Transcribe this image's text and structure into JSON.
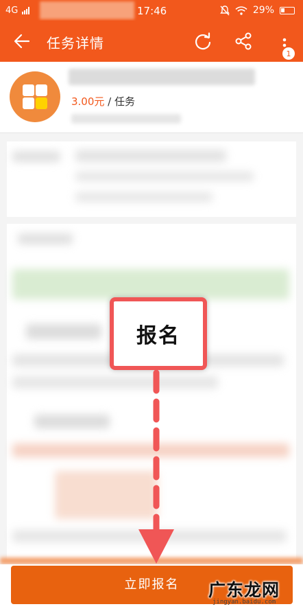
{
  "status_bar": {
    "network": "4G",
    "time": "17:46",
    "battery_percent": "29%"
  },
  "app_bar": {
    "title": "任务详情",
    "notification_count": "1"
  },
  "task": {
    "price": "3.00元",
    "price_unit": " / 任务"
  },
  "annotation": {
    "label": "报名"
  },
  "bottom_button": {
    "label": "立即报名"
  },
  "watermark": {
    "text": "广东龙网",
    "subtext": "jingyan.baidu.com"
  },
  "colors": {
    "brand": "#f2581c",
    "button": "#e8620f",
    "annotation": "#f05656"
  }
}
